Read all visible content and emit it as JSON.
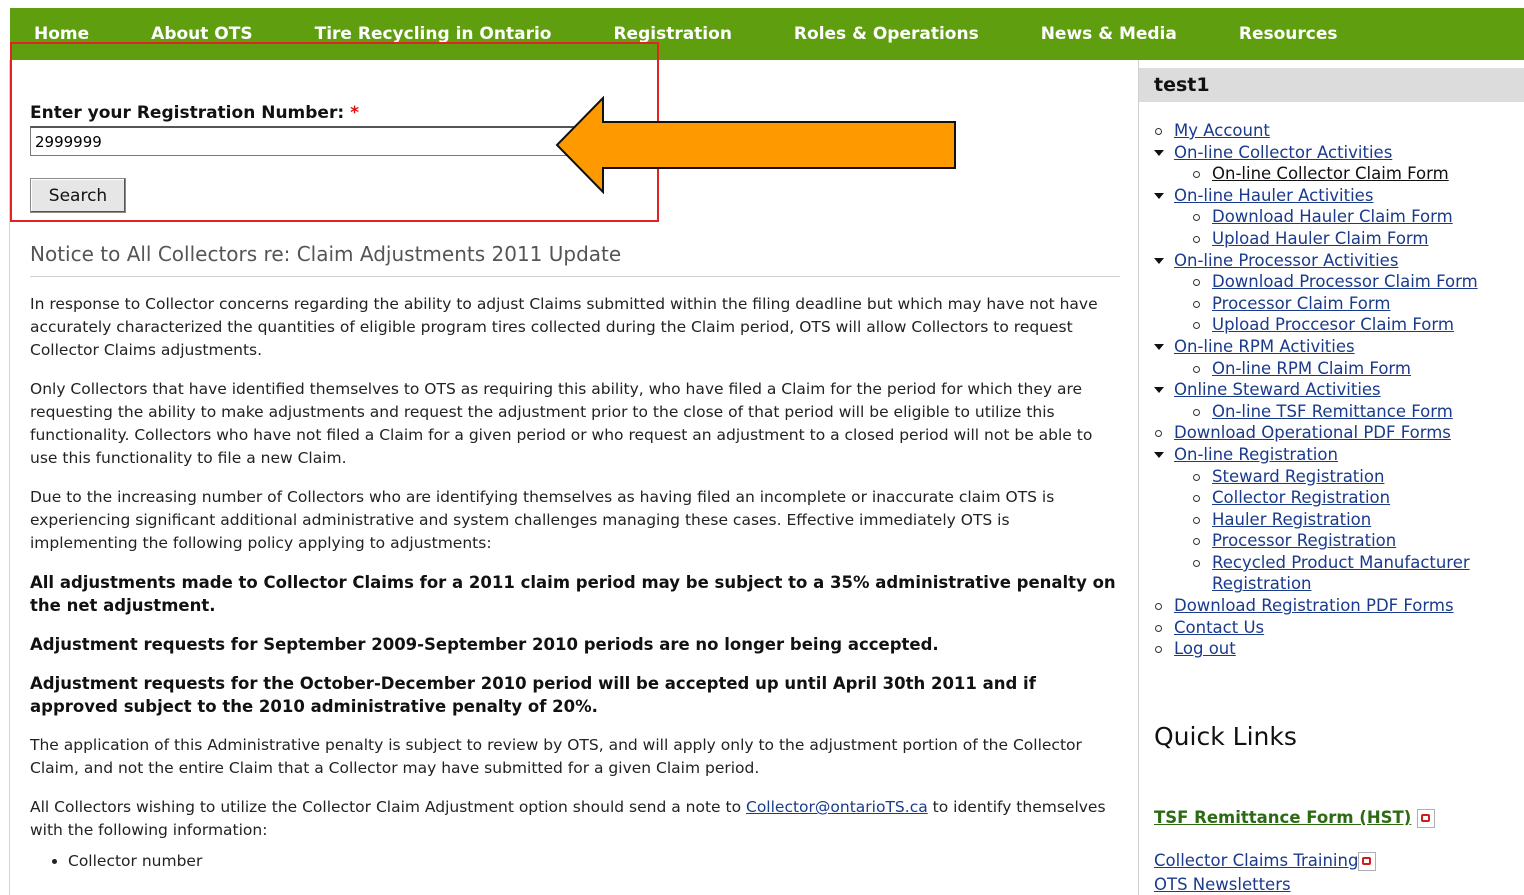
{
  "nav": {
    "items": [
      "Home",
      "About OTS",
      "Tire Recycling in Ontario",
      "Registration",
      "Roles & Operations",
      "News & Media",
      "Resources"
    ]
  },
  "search": {
    "label": "Enter your Registration Number:",
    "required_marker": "*",
    "value": "2999999",
    "button": "Search"
  },
  "notice": {
    "title": "Notice to All Collectors re: Claim Adjustments 2011 Update",
    "p1": "In response to Collector concerns regarding the ability to adjust Claims submitted within the filing deadline but which may have not have accurately characterized the quantities of eligible program tires collected during the Claim period, OTS will allow Collectors to request Collector Claims adjustments.",
    "p2": "Only Collectors that have identified themselves to OTS as requiring this ability, who have filed a Claim for the period for which they are requesting the ability to make adjustments and request the adjustment prior to the close of that period will be eligible to utilize this functionality. Collectors who have not filed a Claim for a given period or who request an adjustment to a closed period will not be able to use this functionality to file a new Claim.",
    "p3": "Due to the increasing number of Collectors who are identifying themselves as having filed an incomplete or inaccurate claim OTS is experiencing significant additional administrative and system challenges managing these cases. Effective immediately OTS is implementing the following policy applying to adjustments:",
    "b1": "All adjustments made to Collector Claims for a 2011 claim period may be subject to a 35% administrative penalty on the net adjustment.",
    "b2": "Adjustment requests for September 2009-September 2010 periods are no longer being accepted.",
    "b3": "Adjustment requests for the October-December 2010 period will be accepted up until April 30th 2011 and if approved subject to the 2010 administrative penalty of 20%.",
    "p4": "The application of this Administrative penalty is subject to review by OTS, and will apply only to the adjustment portion of the Collector Claim, and not the entire Claim that a Collector may have submitted for a given Claim period.",
    "p5_before": "All Collectors wishing to utilize the Collector Claim Adjustment option should send a note to ",
    "p5_email": "Collector@ontarioTS.ca",
    "p5_after": " to identify themselves with the following information:",
    "list": [
      "Collector number"
    ]
  },
  "sidebar": {
    "user": "test1",
    "my_account": "My Account",
    "collector": {
      "label": "On-line Collector Activities",
      "children": [
        "On-line Collector Claim Form"
      ]
    },
    "hauler": {
      "label": "On-line Hauler Activities",
      "children": [
        "Download Hauler Claim Form",
        "Upload Hauler Claim Form"
      ]
    },
    "processor": {
      "label": "On-line Processor Activities",
      "children": [
        "Download Processor Claim Form",
        "Processor Claim Form",
        "Upload Proccesor Claim Form"
      ]
    },
    "rpm": {
      "label": "On-line RPM Activities",
      "children": [
        "On-line RPM Claim Form"
      ]
    },
    "steward": {
      "label": "Online Steward Activities",
      "children": [
        "On-line TSF Remittance Form"
      ]
    },
    "download_forms": "Download Operational PDF Forms",
    "registration": {
      "label": "On-line Registration",
      "children": [
        "Steward Registration",
        "Collector Registration",
        "Hauler Registration",
        "Processor Registration",
        "Recycled Product Manufacturer Registration"
      ]
    },
    "download_reg": "Download Registration PDF Forms",
    "contact": "Contact Us",
    "logout": "Log out",
    "quick_links_title": "Quick Links",
    "tsf_link": "TSF Remittance Form (HST)",
    "training_link": "Collector Claims Training",
    "newsletters_link": "OTS Newsletters"
  },
  "colors": {
    "nav_bg": "#5f9e0f",
    "highlight_border": "#e02424",
    "arrow_fill": "#ff9900"
  },
  "icons": [
    "pdf-icon",
    "arrow-annotation-icon"
  ]
}
